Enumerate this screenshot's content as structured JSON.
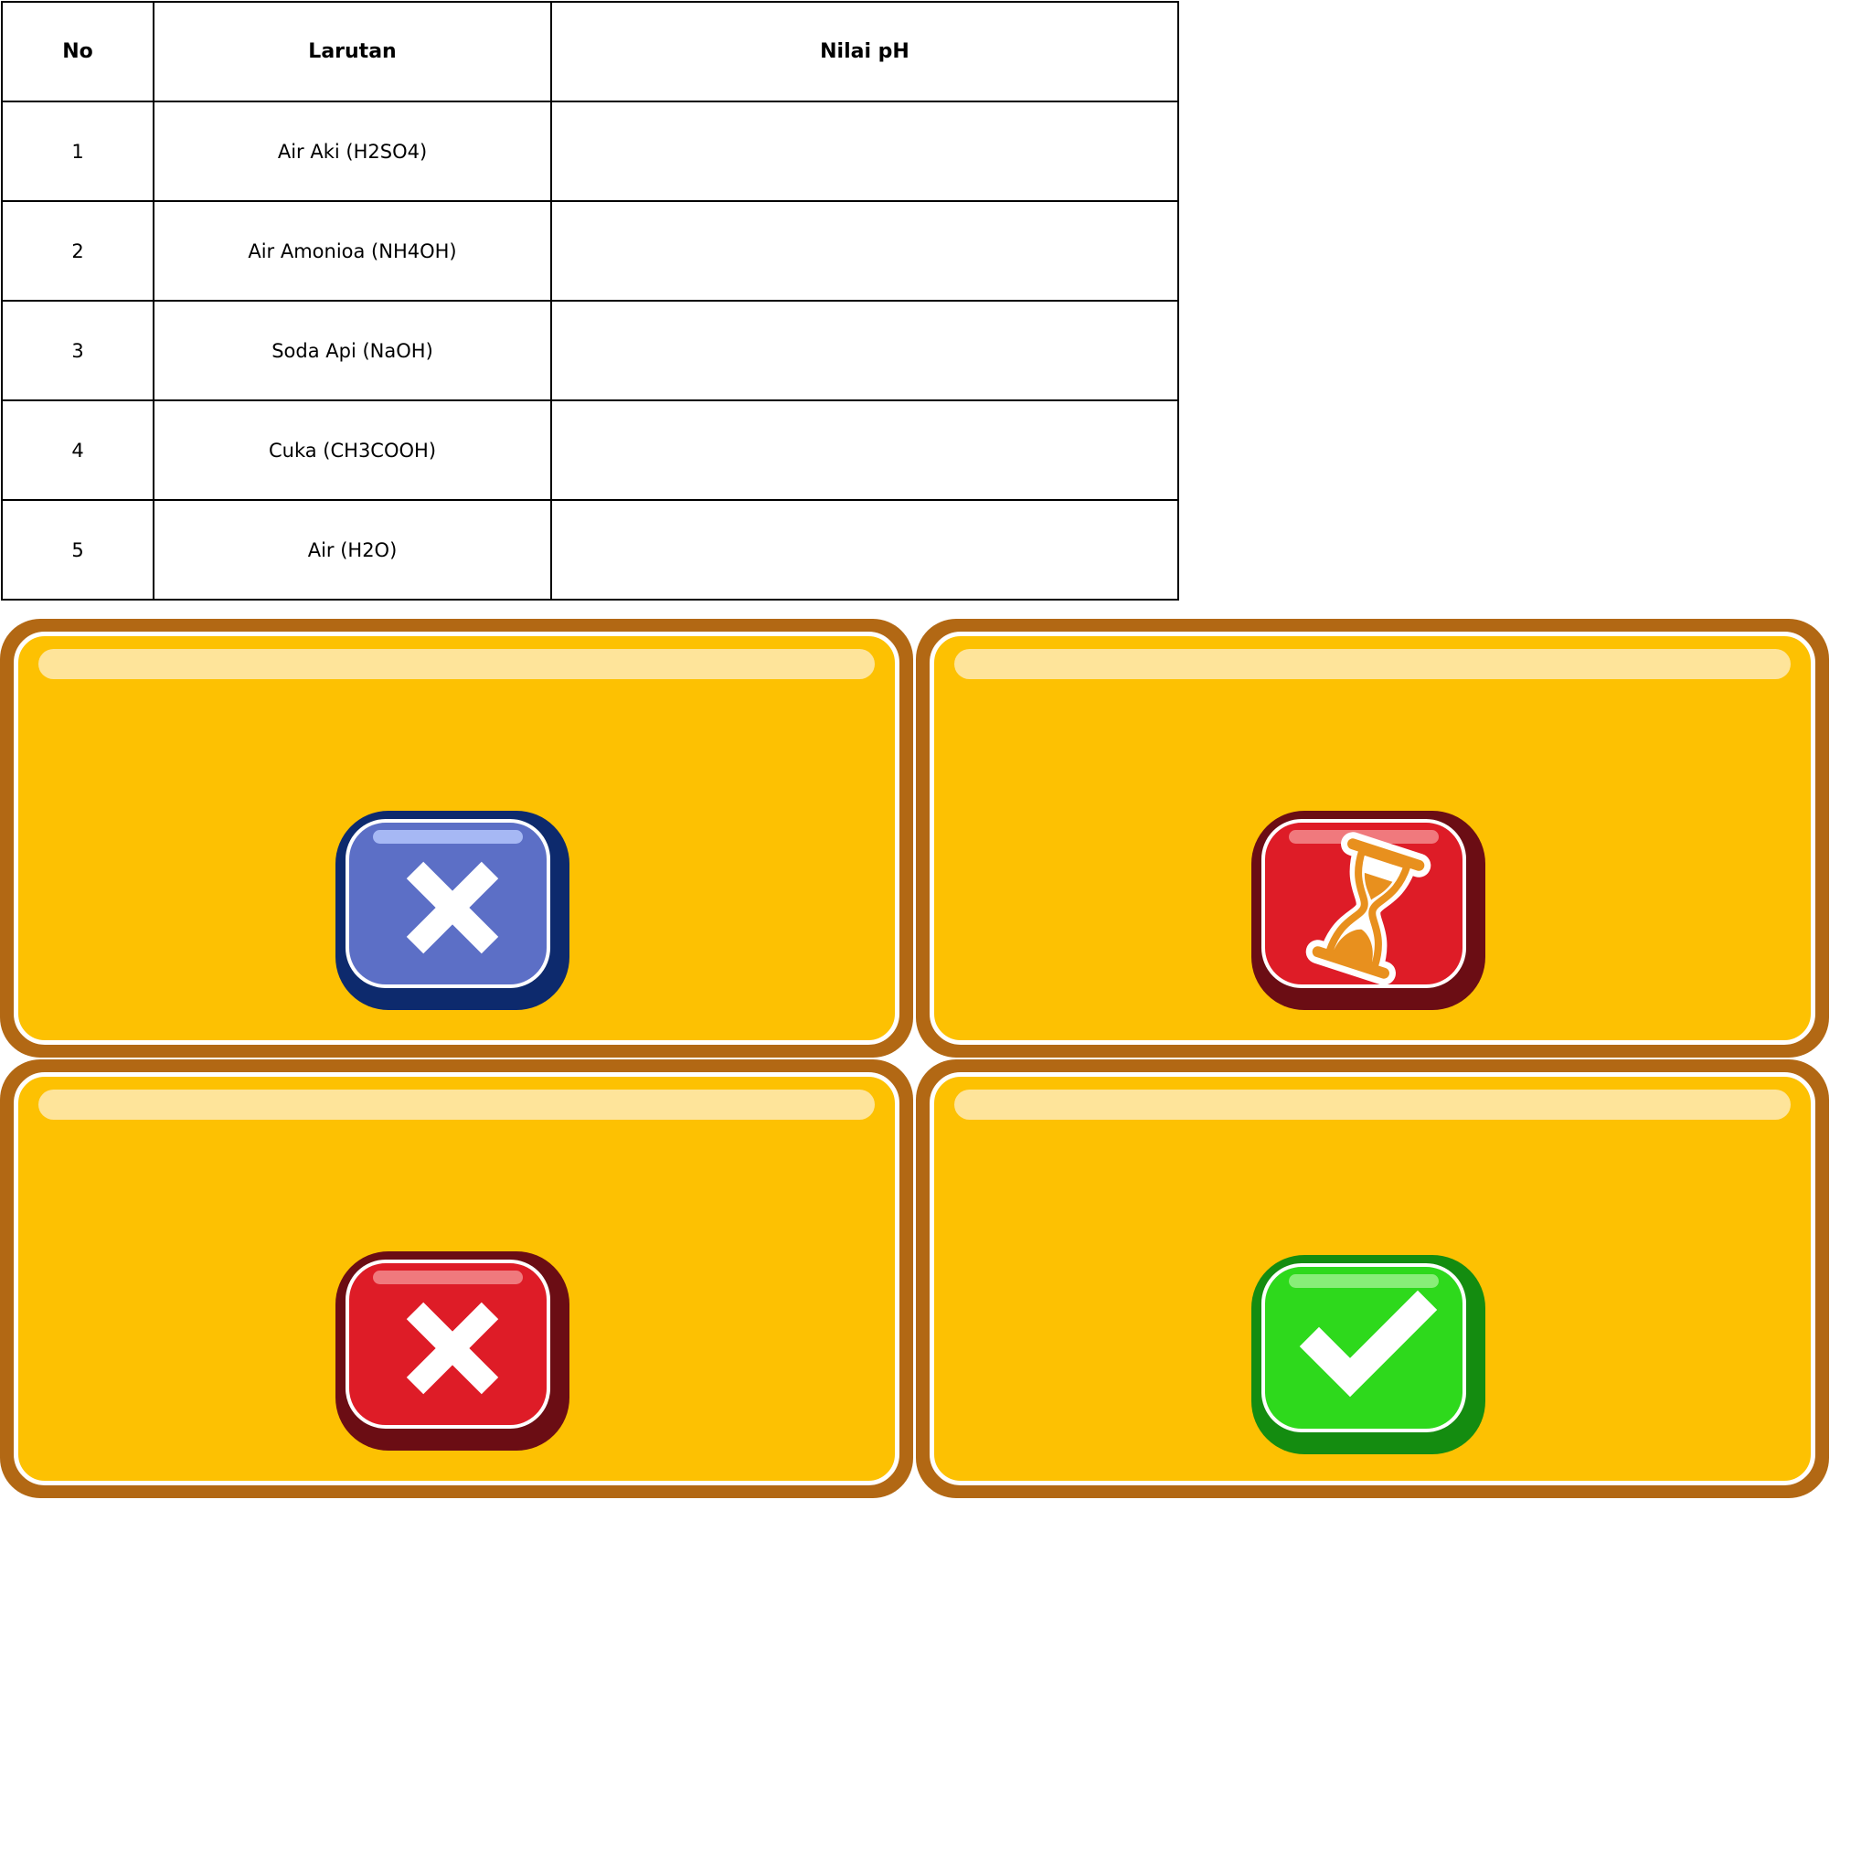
{
  "table": {
    "headers": [
      "No",
      "Larutan",
      "Nilai pH"
    ],
    "rows": [
      {
        "no": "1",
        "larutan": "Air Aki (H2SO4)",
        "nilai_ph": ""
      },
      {
        "no": "2",
        "larutan": "Air Amonioa (NH4OH)",
        "nilai_ph": ""
      },
      {
        "no": "3",
        "larutan": "Soda Api (NaOH)",
        "nilai_ph": ""
      },
      {
        "no": "4",
        "larutan": "Cuka (CH3COOH)",
        "nilai_ph": ""
      },
      {
        "no": "5",
        "larutan": "Air (H2O)",
        "nilai_ph": ""
      }
    ]
  },
  "cards": [
    {
      "button_icon": "close-icon",
      "button_color": "blue"
    },
    {
      "button_icon": "hourglass-icon",
      "button_color": "red"
    },
    {
      "button_icon": "close-icon",
      "button_color": "red"
    },
    {
      "button_icon": "check-icon",
      "button_color": "green"
    }
  ],
  "colors": {
    "card_frame": "#b26814",
    "card_fill": "#fdc102",
    "card_shine": "#fee49a",
    "blue_button": "#5c6fc6",
    "red_button": "#de1c27",
    "green_button": "#2ed91c",
    "hourglass": "#e8901e"
  }
}
